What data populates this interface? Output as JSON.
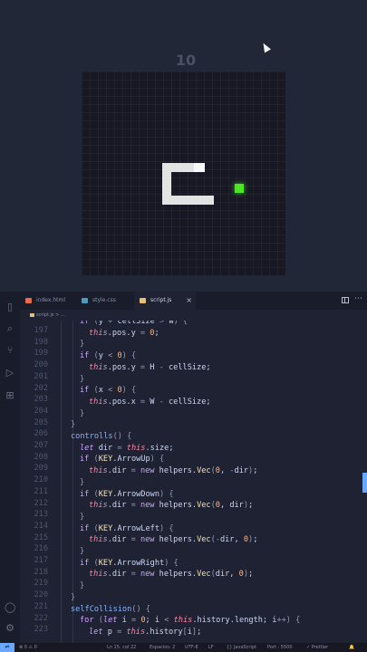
{
  "game": {
    "score": "10"
  },
  "editor": {
    "tabs": [
      {
        "label": "index.html",
        "color": "#e36e4c"
      },
      {
        "label": "style.css",
        "color": "#519aba"
      },
      {
        "label": "script.js",
        "color": "#e5c07b"
      }
    ],
    "close_glyph": "×",
    "breadcrumb": "script.js > ...",
    "line_numbers": [
      "197",
      "198",
      "199",
      "200",
      "201",
      "202",
      "203",
      "204",
      "205",
      "206",
      "207",
      "208",
      "209",
      "210",
      "211",
      "212",
      "213",
      "214",
      "215",
      "216",
      "217",
      "218",
      "219",
      "220",
      "221",
      "222",
      "223"
    ],
    "code_lines": [
      "if (y + cellSize > W) {",
      "this.pos.y = 0;",
      "}",
      "if (y < 0) {",
      "this.pos.y = H - cellSize;",
      "}",
      "if (x < 0) {",
      "this.pos.x = W - cellSize;",
      "}",
      "}",
      "controlls() {",
      "let dir = this.size;",
      "if (KEY.ArrowUp) {",
      "this.dir = new helpers.Vec(0, -dir);",
      "}",
      "if (KEY.ArrowDown) {",
      "this.dir = new helpers.Vec(0, dir);",
      "}",
      "if (KEY.ArrowLeft) {",
      "this.dir = new helpers.Vec(-dir, 0);",
      "}",
      "if (KEY.ArrowRight) {",
      "this.dir = new helpers.Vec(dir, 0);",
      "}",
      "}",
      "selfCollision() {",
      "for (let i = 0; i < this.history.length; i++) {",
      "let p = this.history[i];"
    ]
  },
  "status": {
    "remote": "⇌",
    "problems": "⊗ 0 ⚠ 0",
    "position": "Ln 15, col 22",
    "spaces": "Espacios: 2",
    "encoding": "UTF-8",
    "eol": "LF",
    "language": "{} JavaScript",
    "port": "Port : 5500",
    "prettier": "✓ Prettier",
    "bell": "🔔"
  },
  "colors": {
    "food": "#4ee61f",
    "snake": "#e3e3e3",
    "accent": "#6aa7ff"
  }
}
